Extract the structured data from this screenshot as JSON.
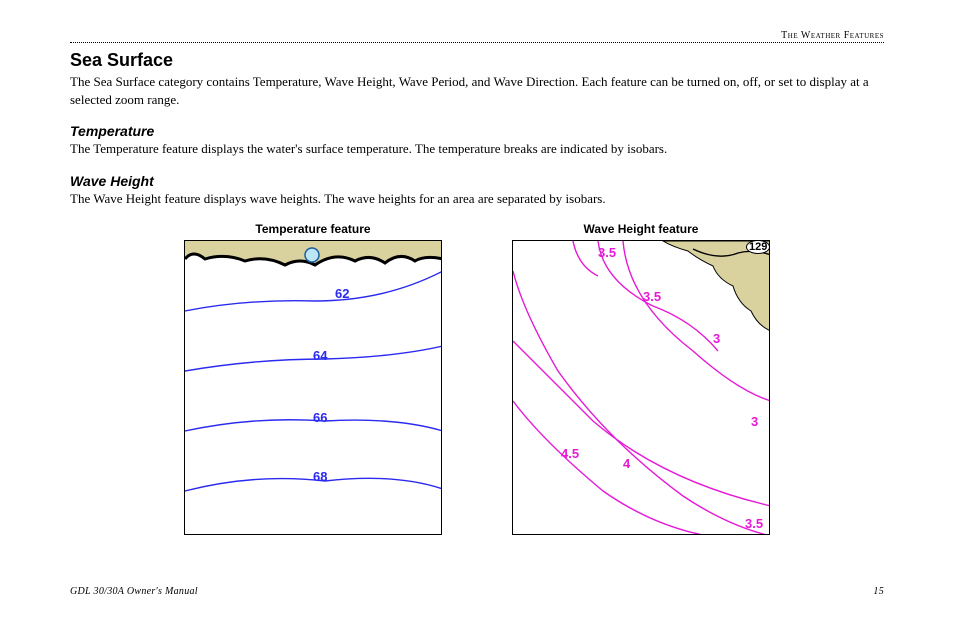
{
  "runningHead": "The Weather Features",
  "section": {
    "title": "Sea Surface",
    "intro": "The Sea Surface category contains Temperature, Wave Height, Wave Period, and Wave Direction. Each feature can be turned on, off, or set to display at a selected zoom range."
  },
  "subs": [
    {
      "title": "Temperature",
      "body": "The Temperature feature displays the water's surface temperature. The temperature breaks are indicated by isobars."
    },
    {
      "title": "Wave Height",
      "body": "The Wave Height feature displays wave heights. The wave heights for an area are separated by isobars."
    }
  ],
  "figures": {
    "temperature": {
      "caption": "Temperature feature",
      "isobars": [
        "62",
        "64",
        "66",
        "68"
      ]
    },
    "waveHeight": {
      "caption": "Wave Height feature",
      "isobars": [
        "3.5",
        "3.5",
        "3",
        "3",
        "4.5",
        "4",
        "3.5"
      ],
      "routeShield": "129"
    }
  },
  "footer": {
    "left": "GDL 30/30A Owner's Manual",
    "right": "15"
  }
}
